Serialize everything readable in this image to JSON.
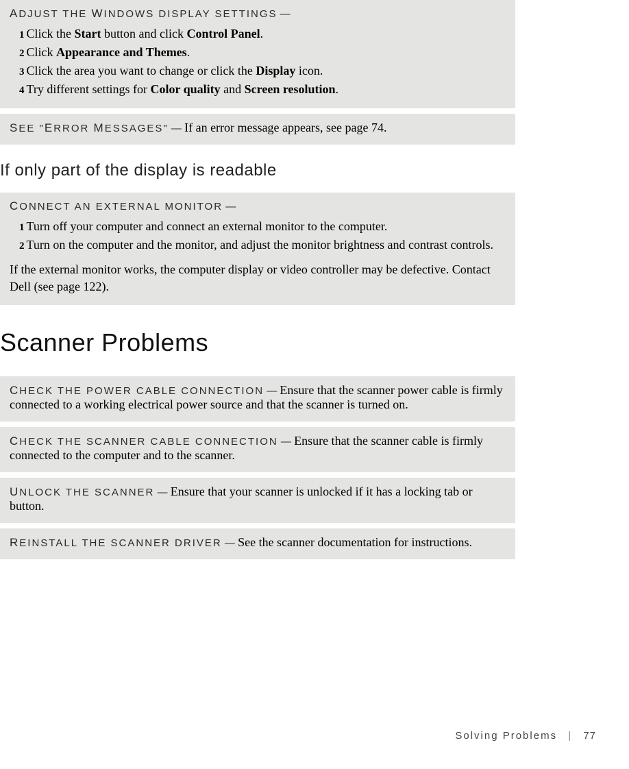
{
  "box1": {
    "heading_first": "A",
    "heading_rest": "DJUST THE ",
    "heading_first2": "W",
    "heading_rest2": "INDOWS DISPLAY SETTINGS",
    "dash": " —",
    "steps": [
      {
        "n": "1",
        "pre": "Click the ",
        "b1": "Start",
        "mid": " button and click ",
        "b2": "Control Panel",
        "post": "."
      },
      {
        "n": "2",
        "pre": "Click ",
        "b1": "Appearance and Themes",
        "mid": "",
        "b2": "",
        "post": "."
      },
      {
        "n": "3",
        "pre": "Click the area you want to change or click the ",
        "b1": "Display",
        "mid": " icon.",
        "b2": "",
        "post": ""
      },
      {
        "n": "4",
        "pre": "Try different settings for ",
        "b1": "Color quality",
        "mid": " and ",
        "b2": "Screen resolution",
        "post": "."
      }
    ]
  },
  "box2": {
    "heading_first": "S",
    "heading_rest": "EE \"",
    "heading_first2": "E",
    "heading_rest2": "RROR ",
    "heading_first3": "M",
    "heading_rest3": "ESSAGES",
    "closeq": "\"",
    "dash": " — ",
    "body": " If an error message appears, see page 74."
  },
  "subheading": "If only part of the display is readable",
  "box3": {
    "heading_first": "C",
    "heading_rest": "ONNECT AN EXTERNAL MONITOR",
    "dash": " —",
    "steps": [
      {
        "n": "1",
        "text": "Turn off your computer and connect an external monitor to the computer."
      },
      {
        "n": "2",
        "text": "Turn on the computer and the monitor, and adjust the monitor brightness and contrast controls."
      }
    ],
    "note": "If the external monitor works, the computer display or video controller may be defective. Contact Dell (see page 122)."
  },
  "section_title": "Scanner Problems",
  "box4": {
    "heading_first": "C",
    "heading_rest": "HECK THE POWER CABLE CONNECTION",
    "dash": " — ",
    "body": " Ensure that the scanner power cable is firmly connected to a working electrical power source and that the scanner is turned on."
  },
  "box5": {
    "heading_first": "C",
    "heading_rest": "HECK THE SCANNER CABLE CONNECTION",
    "dash": " — ",
    "body": " Ensure that the scanner cable is firmly connected to the computer and to the scanner."
  },
  "box6": {
    "heading_first": "U",
    "heading_rest": "NLOCK THE SCANNER",
    "dash": " — ",
    "body": " Ensure that your scanner is unlocked if it has a locking tab or button."
  },
  "box7": {
    "heading_first": "R",
    "heading_rest": "EINSTALL THE SCANNER DRIVER",
    "dash": " — ",
    "body": " See the scanner documentation for instructions."
  },
  "footer": {
    "section": "Solving Problems",
    "page": "77"
  }
}
